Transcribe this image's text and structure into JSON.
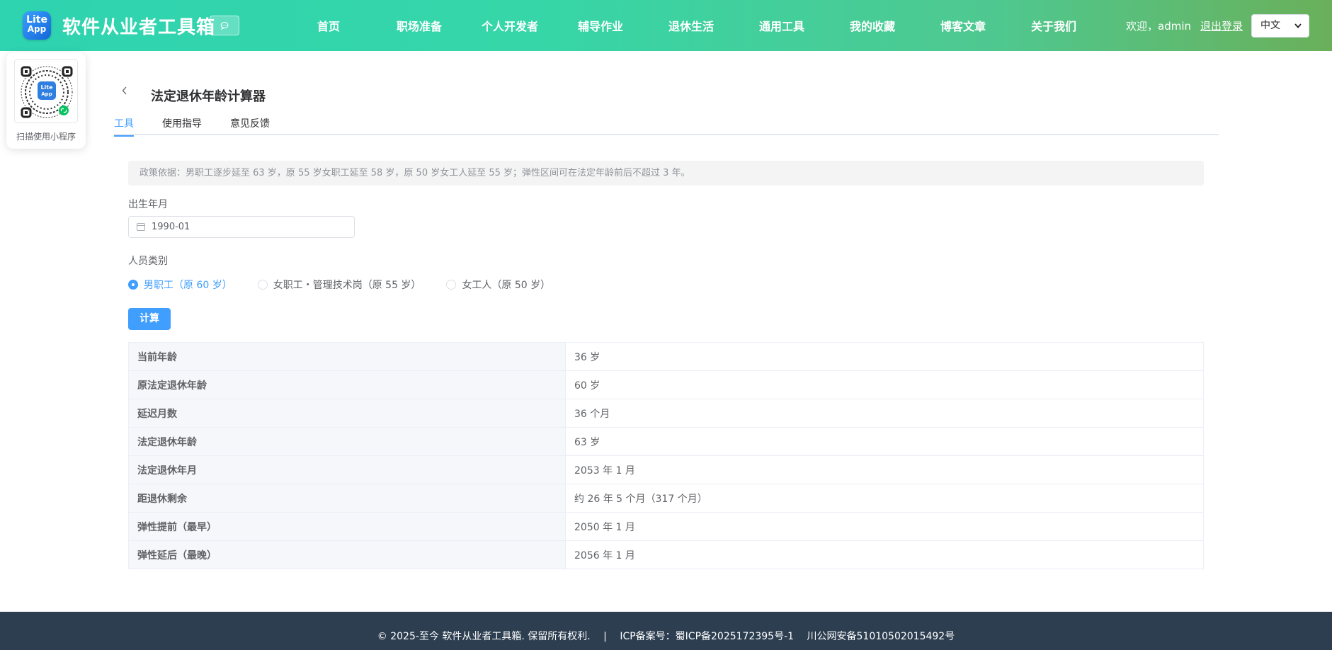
{
  "header": {
    "logo_line1": "Lite",
    "logo_line2": "App",
    "site_title": "软件从业者工具箱",
    "chat_icon": "chat-bubble-icon",
    "nav": [
      "首页",
      "职场准备",
      "个人开发者",
      "辅导作业",
      "退休生活",
      "通用工具",
      "我的收藏",
      "博客文章",
      "关于我们"
    ],
    "welcome": "欢迎，admin",
    "logout": "退出登录",
    "language": "中文"
  },
  "qr": {
    "caption": "扫描使用小程序",
    "logo_line1": "Lite",
    "logo_line2": "App"
  },
  "page": {
    "title": "法定退休年龄计算器",
    "tabs": [
      "工具",
      "使用指导",
      "意见反馈"
    ],
    "active_tab": 0
  },
  "form": {
    "policy": "政策依据：男职工逐步延至 63 岁，原 55 岁女职工延至 58 岁，原 50 岁女工人延至 55 岁；弹性区间可在法定年龄前后不超过 3 年。",
    "birth_label": "出生年月",
    "birth_value": "1990-01",
    "category_label": "人员类别",
    "categories": [
      "男职工（原 60 岁）",
      "女职工・管理技术岗（原 55 岁）",
      "女工人（原 50 岁）"
    ],
    "selected_category": 0,
    "calc_button": "计算"
  },
  "results": [
    {
      "key": "当前年龄",
      "value": "36 岁"
    },
    {
      "key": "原法定退休年龄",
      "value": "60 岁"
    },
    {
      "key": "延迟月数",
      "value": "36 个月"
    },
    {
      "key": "法定退休年龄",
      "value": "63 岁"
    },
    {
      "key": "法定退休年月",
      "value": "2053 年 1 月"
    },
    {
      "key": "距退休剩余",
      "value": "约 26 年 5 个月（317 个月）"
    },
    {
      "key": "弹性提前（最早）",
      "value": "2050 年 1 月"
    },
    {
      "key": "弹性延后（最晚）",
      "value": "2056 年 1 月"
    }
  ],
  "footer": {
    "copyright": "© 2025-至今 软件从业者工具箱. 保留所有权利.",
    "separator": "|",
    "icp": "ICP备案号：蜀ICP备2025172395号-1",
    "psb": "川公网安备51010502015492号"
  }
}
